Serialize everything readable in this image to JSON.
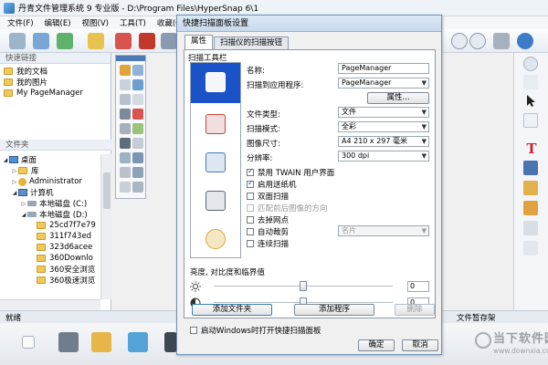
{
  "window": {
    "title": "丹青文件管理系统 9 专业版 - D:\\Program Files\\HyperSnap 6\\1"
  },
  "menu": [
    "文件(F)",
    "编辑(E)",
    "视图(V)",
    "工具(T)",
    "收藏(O)",
    "页"
  ],
  "left_panel": {
    "quick_links_header": "快速链接",
    "quick_links": [
      "我的文档",
      "我的图片",
      "My PageManager"
    ],
    "folders_header": "文件夹",
    "tree": [
      {
        "label": "桌面",
        "icon": "desktop-icon"
      },
      {
        "label": "库",
        "icon": "folder-icon"
      },
      {
        "label": "Administrator",
        "icon": "user-icon"
      },
      {
        "label": "计算机",
        "icon": "computer-icon"
      },
      {
        "label": "本地磁盘 (C:)",
        "icon": "drive-icon"
      },
      {
        "label": "本地磁盘 (D:)",
        "icon": "drive-icon"
      },
      {
        "label": "25cd7f7e79",
        "icon": "folder-icon"
      },
      {
        "label": "311f743ed",
        "icon": "folder-icon"
      },
      {
        "label": "323d6acee",
        "icon": "folder-icon"
      },
      {
        "label": "360Downlo",
        "icon": "folder-icon"
      },
      {
        "label": "360安全浏览",
        "icon": "folder-icon"
      },
      {
        "label": "360极速浏览",
        "icon": "folder-icon"
      }
    ]
  },
  "dialog": {
    "title": "快捷扫描面板设置",
    "tabs": [
      "属性",
      "扫描仪的扫描按钮"
    ],
    "toolbar_group_label": "扫描工具栏",
    "scan_items": [
      "scan-to-app-icon",
      "scan-to-pdf-icon",
      "scan-to-ocr-icon",
      "scan-to-xps-icon",
      "scan-to-paint-icon"
    ],
    "fields": {
      "name_label": "名称:",
      "name_value": "PageManager",
      "scan_to_app_label": "扫描到应用程序:",
      "scan_to_app_value": "PageManager",
      "properties_button": "属性...",
      "file_type_label": "文件类型:",
      "file_type_value": "文件",
      "scan_mode_label": "扫描模式:",
      "scan_mode_value": "全彩",
      "image_size_label": "图像尺寸:",
      "image_size_value": "A4 210 x 297 毫米",
      "resolution_label": "分辨率:",
      "resolution_value": "300 dpi"
    },
    "checkboxes": [
      {
        "label": "禁用 TWAIN 用户界面",
        "checked": true,
        "enabled": true
      },
      {
        "label": "启用送纸机",
        "checked": true,
        "enabled": true
      },
      {
        "label": "双面扫描",
        "checked": false,
        "enabled": true
      },
      {
        "label": "匹配前后图像的方向",
        "checked": false,
        "enabled": false
      },
      {
        "label": "去掉网点",
        "checked": false,
        "enabled": true
      },
      {
        "label": "自动裁剪",
        "checked": false,
        "enabled": true
      },
      {
        "label": "连续扫描",
        "checked": false,
        "enabled": true
      }
    ],
    "auto_crop_option": "名片",
    "brightness_label": "亮度, 对比度和临界值",
    "sliders": [
      {
        "icon": "sun-icon",
        "value": "0",
        "position": 0.5
      },
      {
        "icon": "contrast-icon",
        "value": "0",
        "position": 0.5
      }
    ],
    "buttons": {
      "add_file": "添加文件夹",
      "add_program": "添加程序",
      "remove": "删除",
      "ok": "确定",
      "cancel": "取消"
    },
    "startup_checkbox": "启动Windows时打开快捷扫描面板"
  },
  "statusbar": {
    "left": "就绪",
    "right": "文件暂存架"
  },
  "watermark": {
    "text": "当下软件园",
    "url": "www.downxia.com"
  }
}
